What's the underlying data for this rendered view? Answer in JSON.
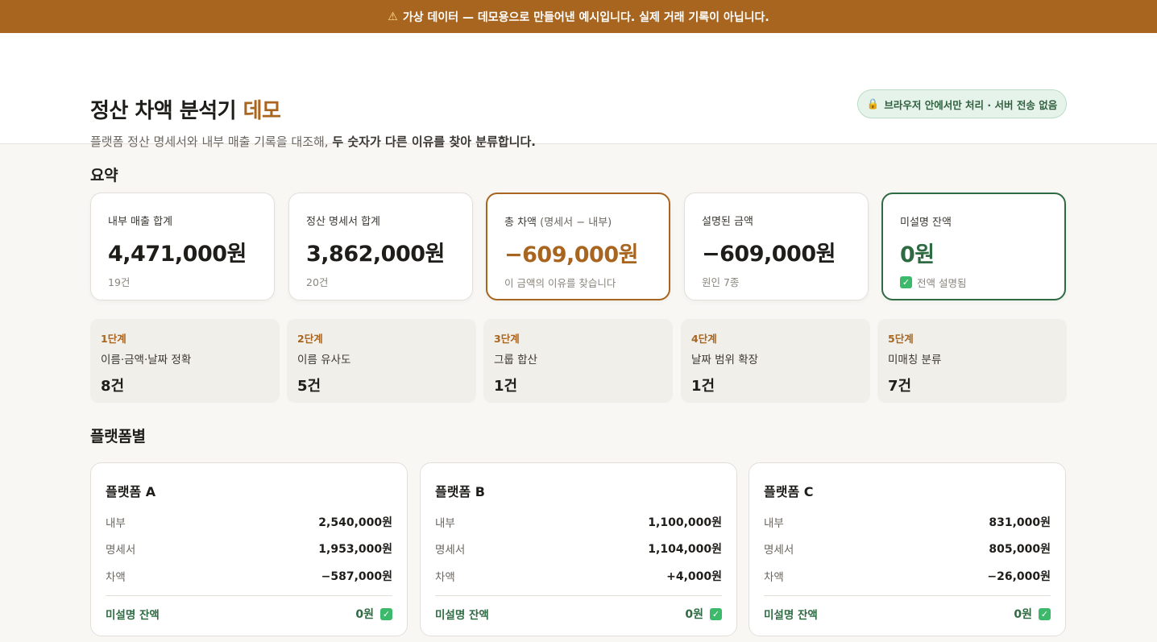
{
  "banner": {
    "icon": "warning-icon",
    "text": "가상 데이터 — 데모용으로 만들어낸 예시입니다. 실제 거래 기록이 아닙니다."
  },
  "header": {
    "title_main": "정산 차액 분석기",
    "title_accent": "데모",
    "subtitle_plain": "플랫폼 정산 명세서와 내부 매출 기록을 대조해, ",
    "subtitle_bold": "두 숫자가 다른 이유를 찾아 분류합니다.",
    "privacy_icon": "lock-icon",
    "privacy": "브라우저 안에서만 처리 · 서버 전송 없음"
  },
  "summary": {
    "title": "요약",
    "cards": [
      {
        "label": "내부 매출 합계",
        "label_paren": "",
        "value": "4,471,000원",
        "sub": "19건"
      },
      {
        "label": "정산 명세서 합계",
        "label_paren": "",
        "value": "3,862,000원",
        "sub": "20건"
      },
      {
        "label": "총 차액",
        "label_paren": " (명세서 − 내부)",
        "value": "−609,000원",
        "sub": "이 금액의 이유를 찾습니다"
      },
      {
        "label": "설명된 금액",
        "label_paren": "",
        "value": "−609,000원",
        "sub": "원인 7종"
      },
      {
        "label": "미설명 잔액",
        "label_paren": "",
        "value": "0원",
        "sub": "전액 설명됨"
      }
    ]
  },
  "steps": [
    {
      "step": "1단계",
      "desc": "이름·금액·날짜 정확",
      "count": "8건"
    },
    {
      "step": "2단계",
      "desc": "이름 유사도",
      "count": "5건"
    },
    {
      "step": "3단계",
      "desc": "그룹 합산",
      "count": "1건"
    },
    {
      "step": "4단계",
      "desc": "날짜 범위 확장",
      "count": "1건"
    },
    {
      "step": "5단계",
      "desc": "미매칭 분류",
      "count": "7건"
    }
  ],
  "platforms": {
    "title": "플랫폼별",
    "row_labels": {
      "internal": "내부",
      "statement": "명세서",
      "diff": "차액",
      "unexplained": "미설명 잔액"
    },
    "items": [
      {
        "name": "플랫폼 A",
        "internal": "2,540,000원",
        "statement": "1,953,000원",
        "diff": "−587,000원",
        "unexplained": "0원"
      },
      {
        "name": "플랫폼 B",
        "internal": "1,100,000원",
        "statement": "1,104,000원",
        "diff": "+4,000원",
        "unexplained": "0원"
      },
      {
        "name": "플랫폼 C",
        "internal": "831,000원",
        "statement": "805,000원",
        "diff": "−26,000원",
        "unexplained": "0원"
      }
    ]
  },
  "colors": {
    "accent": "#a8651f",
    "success": "#2e6b42",
    "check": "#3cb96a"
  }
}
